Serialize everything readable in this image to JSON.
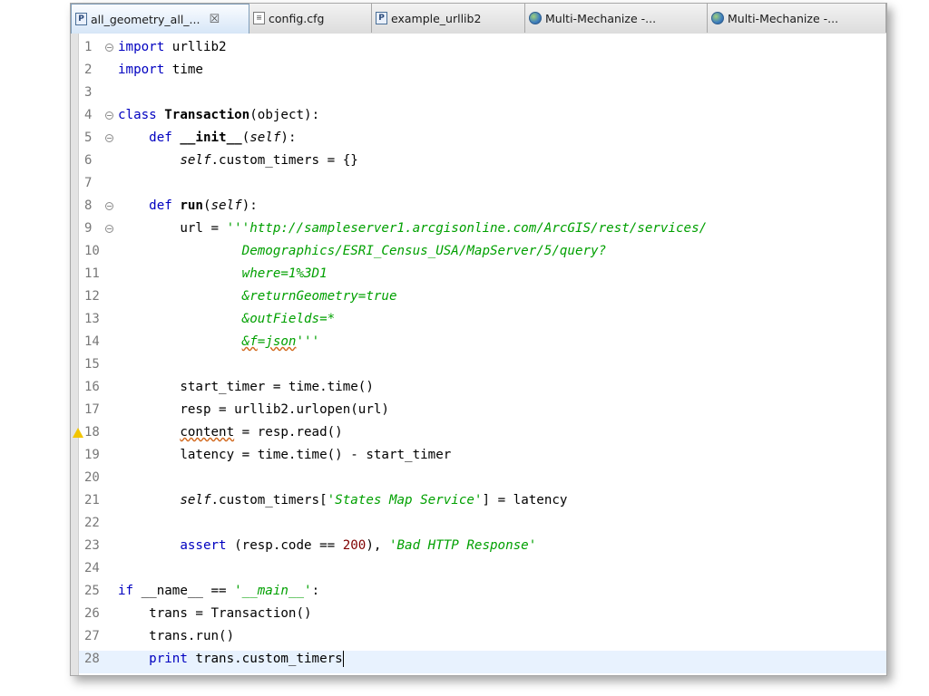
{
  "tabs": [
    {
      "label": "all_geometry_all_...",
      "icon": "python-file-icon",
      "active": true,
      "close": "☒"
    },
    {
      "label": "config.cfg",
      "icon": "text-file-icon",
      "active": false
    },
    {
      "label": "example_urllib2",
      "icon": "python-file-icon",
      "active": false
    },
    {
      "label": "Multi-Mechanize -...",
      "icon": "globe-icon",
      "active": false
    },
    {
      "label": "Multi-Mechanize -...",
      "icon": "globe-icon",
      "active": false
    }
  ],
  "editor": {
    "line_numbers": [
      "1",
      "2",
      "3",
      "4",
      "5",
      "6",
      "7",
      "8",
      "9",
      "10",
      "11",
      "12",
      "13",
      "14",
      "15",
      "16",
      "17",
      "18",
      "19",
      "20",
      "21",
      "22",
      "23",
      "24",
      "25",
      "26",
      "27",
      "28"
    ],
    "warning_line": "18",
    "code": {
      "l1_kw": "import",
      "l1_rest": " urllib2",
      "l2_kw": "import",
      "l2_rest": " time",
      "l4_kw": "class",
      "l4_name": "Transaction",
      "l4_rest": "(object):",
      "l5_kw": "def",
      "l5_name": "__init__",
      "l5_p1": "(",
      "l5_self": "self",
      "l5_p2": "):",
      "l6_self": "self",
      "l6_rest": ".custom_timers = {}",
      "l8_kw": "def",
      "l8_name": "run",
      "l8_p1": "(",
      "l8_self": "self",
      "l8_p2": "):",
      "l9_pre": "url = ",
      "l9_str": "'''http://sampleserver1.arcgisonline.com/ArcGIS/rest/services/",
      "l10_str": "Demographics/ESRI_Census_USA/MapServer/5/query?",
      "l11_str": "where=1%3D1",
      "l12_str": "&returnGeometry=true",
      "l13_str": "&outFields=*",
      "l14_str_a": "&f",
      "l14_str_b": "=",
      "l14_str_c": "json",
      "l14_str_d": "'''",
      "l16": "start_timer = time.time()",
      "l17": "resp = urllib2.urlopen(url)",
      "l18_var": "content",
      "l18_rest": " = resp.read()",
      "l19": "latency = time.time() - start_timer",
      "l21_self": "self",
      "l21_mid": ".custom_timers[",
      "l21_str": "'States Map Service'",
      "l21_rest": "] = latency",
      "l23_kw": "assert",
      "l23_a": " (resp.code == ",
      "l23_num": "200",
      "l23_b": "), ",
      "l23_str": "'Bad HTTP Response'",
      "l25_kw": "if",
      "l25_a": " __name__ == ",
      "l25_str": "'__main__'",
      "l25_b": ":",
      "l26": "trans = Transaction()",
      "l27": "trans.run()",
      "l28_kw": "print",
      "l28_rest": " trans.custom_timers"
    }
  }
}
